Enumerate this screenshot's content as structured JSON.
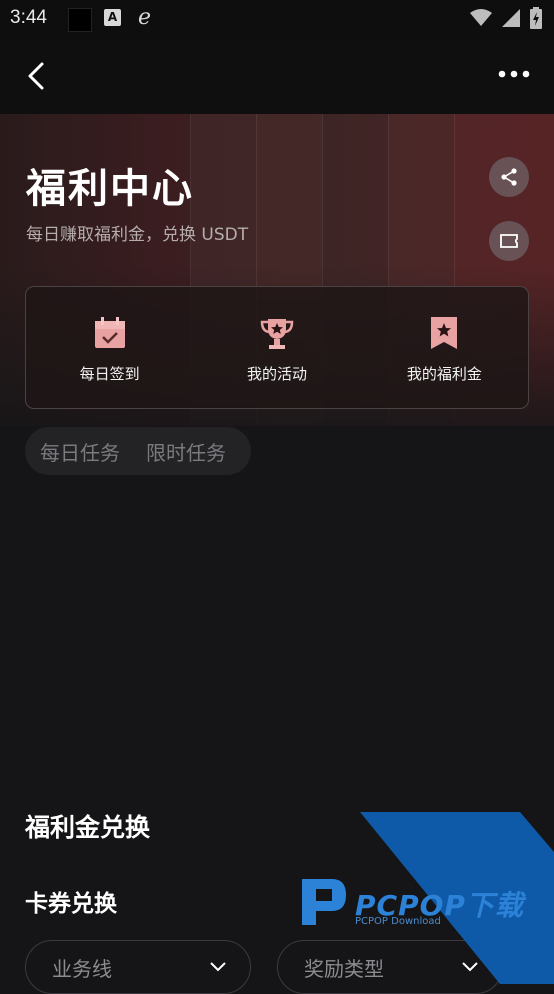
{
  "status_bar": {
    "time": "3:44",
    "a_icon": "A"
  },
  "header": {
    "title": "福利中心",
    "subtitle": "每日赚取福利金，兑换 USDT"
  },
  "card": {
    "items": [
      {
        "label": "每日签到",
        "icon": "calendar-check-icon"
      },
      {
        "label": "我的活动",
        "icon": "trophy-icon"
      },
      {
        "label": "我的福利金",
        "icon": "bookmark-star-icon"
      }
    ]
  },
  "tasks": {
    "tabs": [
      "每日任务",
      "限时任务"
    ]
  },
  "exchange": {
    "section_title": "福利金兑换",
    "coupon_title": "卡券兑换",
    "filters": [
      {
        "label": "业务线"
      },
      {
        "label": "奖励类型"
      }
    ]
  },
  "watermark": {
    "brand": "PCPOP下载",
    "sub": "PCPOP Download"
  },
  "colors": {
    "accent_red": "#e9a2a2",
    "background": "#151517",
    "watermark_blue": "#0f5aa8"
  }
}
